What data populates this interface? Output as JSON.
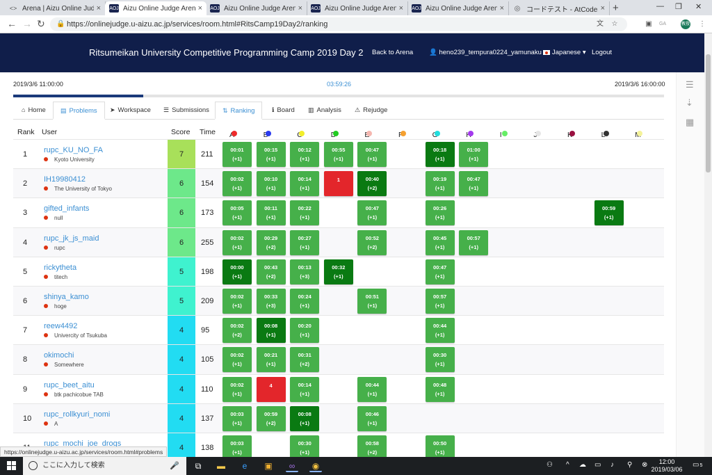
{
  "browser": {
    "tabs": [
      {
        "title": "Arena | Aizu Online Judge",
        "icon": "code-icon"
      },
      {
        "title": "Aizu Online Judge Arena",
        "icon": "aoj-icon",
        "active": true
      },
      {
        "title": "Aizu Online Judge Arena",
        "icon": "aoj-icon"
      },
      {
        "title": "Aizu Online Judge Arena",
        "icon": "aoj-icon"
      },
      {
        "title": "Aizu Online Judge Arena",
        "icon": "aoj-icon"
      },
      {
        "title": "コードテスト - AtCoder Beginne",
        "icon": "atcoder-icon"
      }
    ],
    "url": "https://onlinejudge.u-aizu.ac.jp/services/room.html#RitsCamp19Day2/ranking",
    "status_url": "https://onlinejudge.u-aizu.ac.jp/services/room.html#problems",
    "profile_initials": "教授",
    "ext_label": "GA"
  },
  "site": {
    "title": "Ritsumeikan University Competitive Programming Camp 2019 Day 2",
    "back_label": "Back to Arena",
    "user": "heno239_tempura0224_yamunaku",
    "language": "Japanese",
    "logout": "Logout"
  },
  "contest": {
    "start": "2019/3/6 11:00:00",
    "remaining": "03:59:26",
    "end": "2019/3/6 16:00:00",
    "elapsed_fraction": 0.2
  },
  "nav": {
    "home": "Home",
    "problems": "Problems",
    "workspace": "Workspace",
    "submissions": "Submissions",
    "ranking": "Ranking",
    "board": "Board",
    "analysis": "Analysis",
    "rejudge": "Rejudge"
  },
  "ranking": {
    "headers": {
      "rank": "Rank",
      "user": "User",
      "score": "Score",
      "time": "Time"
    },
    "problems": [
      {
        "label": "A",
        "color": "#ee2a2a"
      },
      {
        "label": "B",
        "color": "#2a3aee"
      },
      {
        "label": "C",
        "color": "#f2ee2a"
      },
      {
        "label": "D",
        "color": "#22cc22"
      },
      {
        "label": "E",
        "color": "#f5b7b0"
      },
      {
        "label": "F",
        "color": "#f5a030"
      },
      {
        "label": "G",
        "color": "#22dddd"
      },
      {
        "label": "H",
        "color": "#a43aee"
      },
      {
        "label": "I",
        "color": "#66ee66"
      },
      {
        "label": "J",
        "color": "#e6e6e6"
      },
      {
        "label": "K",
        "color": "#9a1040"
      },
      {
        "label": "L",
        "color": "#333333"
      },
      {
        "label": "M",
        "color": "#f5f39a"
      }
    ],
    "rows": [
      {
        "rank": "1",
        "user": "rupc_KU_NO_FA",
        "affiliation": "Kyoto University",
        "score": "7",
        "time": "211",
        "score_color": "#a8e05a",
        "cells": [
          {
            "p": 0,
            "t": "00:01",
            "s": "(+1)",
            "k": "ac"
          },
          {
            "p": 1,
            "t": "00:15",
            "s": "(+1)",
            "k": "ac"
          },
          {
            "p": 2,
            "t": "00:12",
            "s": "(+1)",
            "k": "ac"
          },
          {
            "p": 3,
            "t": "00:55",
            "s": "(+1)",
            "k": "ac"
          },
          {
            "p": 4,
            "t": "00:47",
            "s": "(+1)",
            "k": "ac"
          },
          {
            "p": 6,
            "t": "00:18",
            "s": "(+1)",
            "k": "fa"
          },
          {
            "p": 7,
            "t": "01:00",
            "s": "(+1)",
            "k": "ac"
          }
        ]
      },
      {
        "rank": "2",
        "user": "IH19980412",
        "affiliation": "The University of Tokyo",
        "score": "6",
        "time": "154",
        "score_color": "#6de88a",
        "cells": [
          {
            "p": 0,
            "t": "00:02",
            "s": "(+1)",
            "k": "ac"
          },
          {
            "p": 1,
            "t": "00:10",
            "s": "(+1)",
            "k": "ac"
          },
          {
            "p": 2,
            "t": "00:14",
            "s": "(+1)",
            "k": "ac"
          },
          {
            "p": 3,
            "t": "1",
            "s": "",
            "k": "wa"
          },
          {
            "p": 4,
            "t": "00:40",
            "s": "(+2)",
            "k": "fa"
          },
          {
            "p": 6,
            "t": "00:19",
            "s": "(+1)",
            "k": "ac"
          },
          {
            "p": 7,
            "t": "00:47",
            "s": "(+1)",
            "k": "ac"
          }
        ]
      },
      {
        "rank": "3",
        "user": "gifted_infants",
        "affiliation": "null",
        "score": "6",
        "time": "173",
        "score_color": "#6de88a",
        "cells": [
          {
            "p": 0,
            "t": "00:05",
            "s": "(+1)",
            "k": "ac"
          },
          {
            "p": 1,
            "t": "00:11",
            "s": "(+1)",
            "k": "ac"
          },
          {
            "p": 2,
            "t": "00:22",
            "s": "(+1)",
            "k": "ac"
          },
          {
            "p": 4,
            "t": "00:47",
            "s": "(+1)",
            "k": "ac"
          },
          {
            "p": 6,
            "t": "00:26",
            "s": "(+1)",
            "k": "ac"
          },
          {
            "p": 11,
            "t": "00:59",
            "s": "(+1)",
            "k": "fa"
          }
        ]
      },
      {
        "rank": "4",
        "user": "rupc_jk_js_maid",
        "affiliation": "rupc",
        "score": "6",
        "time": "255",
        "score_color": "#6de88a",
        "cells": [
          {
            "p": 0,
            "t": "00:02",
            "s": "(+1)",
            "k": "ac"
          },
          {
            "p": 1,
            "t": "00:29",
            "s": "(+2)",
            "k": "ac"
          },
          {
            "p": 2,
            "t": "00:27",
            "s": "(+1)",
            "k": "ac"
          },
          {
            "p": 4,
            "t": "00:52",
            "s": "(+2)",
            "k": "ac"
          },
          {
            "p": 6,
            "t": "00:45",
            "s": "(+1)",
            "k": "ac"
          },
          {
            "p": 7,
            "t": "00:57",
            "s": "(+1)",
            "k": "ac"
          }
        ]
      },
      {
        "rank": "5",
        "user": "rickytheta",
        "affiliation": "titech",
        "score": "5",
        "time": "198",
        "score_color": "#3ff2cf",
        "cells": [
          {
            "p": 0,
            "t": "00:00",
            "s": "(+1)",
            "k": "fa"
          },
          {
            "p": 1,
            "t": "00:43",
            "s": "(+2)",
            "k": "ac"
          },
          {
            "p": 2,
            "t": "00:13",
            "s": "(+3)",
            "k": "ac"
          },
          {
            "p": 3,
            "t": "00:32",
            "s": "(+1)",
            "k": "fa"
          },
          {
            "p": 6,
            "t": "00:47",
            "s": "(+1)",
            "k": "ac"
          }
        ]
      },
      {
        "rank": "6",
        "user": "shinya_kamo",
        "affiliation": "hoge",
        "score": "5",
        "time": "209",
        "score_color": "#3ff2cf",
        "cells": [
          {
            "p": 0,
            "t": "00:02",
            "s": "(+1)",
            "k": "ac"
          },
          {
            "p": 1,
            "t": "00:33",
            "s": "(+3)",
            "k": "ac"
          },
          {
            "p": 2,
            "t": "00:24",
            "s": "(+1)",
            "k": "ac"
          },
          {
            "p": 4,
            "t": "00:51",
            "s": "(+1)",
            "k": "ac"
          },
          {
            "p": 6,
            "t": "00:57",
            "s": "(+1)",
            "k": "ac"
          }
        ]
      },
      {
        "rank": "7",
        "user": "reew4492",
        "affiliation": "Univercity of Tsukuba",
        "score": "4",
        "time": "95",
        "score_color": "#22dcf2",
        "cells": [
          {
            "p": 0,
            "t": "00:02",
            "s": "(+2)",
            "k": "ac"
          },
          {
            "p": 1,
            "t": "00:08",
            "s": "(+1)",
            "k": "fa"
          },
          {
            "p": 2,
            "t": "00:20",
            "s": "(+1)",
            "k": "ac"
          },
          {
            "p": 6,
            "t": "00:44",
            "s": "(+1)",
            "k": "ac"
          }
        ]
      },
      {
        "rank": "8",
        "user": "okimochi",
        "affiliation": "Somewhere",
        "score": "4",
        "time": "105",
        "score_color": "#22dcf2",
        "cells": [
          {
            "p": 0,
            "t": "00:02",
            "s": "(+1)",
            "k": "ac"
          },
          {
            "p": 1,
            "t": "00:21",
            "s": "(+1)",
            "k": "ac"
          },
          {
            "p": 2,
            "t": "00:31",
            "s": "(+2)",
            "k": "ac"
          },
          {
            "p": 6,
            "t": "00:30",
            "s": "(+1)",
            "k": "ac"
          }
        ]
      },
      {
        "rank": "9",
        "user": "rupc_beet_aitu",
        "affiliation": "btk pachicobue TAB",
        "score": "4",
        "time": "110",
        "score_color": "#22dcf2",
        "cells": [
          {
            "p": 0,
            "t": "00:02",
            "s": "(+1)",
            "k": "ac"
          },
          {
            "p": 1,
            "t": "4",
            "s": "",
            "k": "wa"
          },
          {
            "p": 2,
            "t": "00:14",
            "s": "(+1)",
            "k": "ac"
          },
          {
            "p": 4,
            "t": "00:44",
            "s": "(+1)",
            "k": "ac"
          },
          {
            "p": 6,
            "t": "00:48",
            "s": "(+1)",
            "k": "ac"
          }
        ]
      },
      {
        "rank": "10",
        "user": "rupc_rollkyuri_nomi",
        "affiliation": "A",
        "score": "4",
        "time": "137",
        "score_color": "#22dcf2",
        "cells": [
          {
            "p": 0,
            "t": "00:03",
            "s": "(+1)",
            "k": "ac"
          },
          {
            "p": 1,
            "t": "00:59",
            "s": "(+2)",
            "k": "ac"
          },
          {
            "p": 2,
            "t": "00:08",
            "s": "(+1)",
            "k": "fa"
          },
          {
            "p": 4,
            "t": "00:46",
            "s": "(+1)",
            "k": "ac"
          }
        ]
      },
      {
        "rank": "11",
        "user": "rupc_mochi_joe_drogs",
        "affiliation": "",
        "score": "4",
        "time": "138",
        "score_color": "#22dcf2",
        "cells": [
          {
            "p": 0,
            "t": "00:03",
            "s": "(+1)",
            "k": "ac"
          },
          {
            "p": 2,
            "t": "00:30",
            "s": "(+1)",
            "k": "ac"
          },
          {
            "p": 4,
            "t": "00:58",
            "s": "(+2)",
            "k": "ac"
          },
          {
            "p": 6,
            "t": "00:50",
            "s": "(+1)",
            "k": "ac"
          }
        ]
      }
    ]
  },
  "taskbar": {
    "search_placeholder": "ここに入力して検索",
    "time": "12:00",
    "date": "2019/03/06",
    "notif_count": "5"
  }
}
